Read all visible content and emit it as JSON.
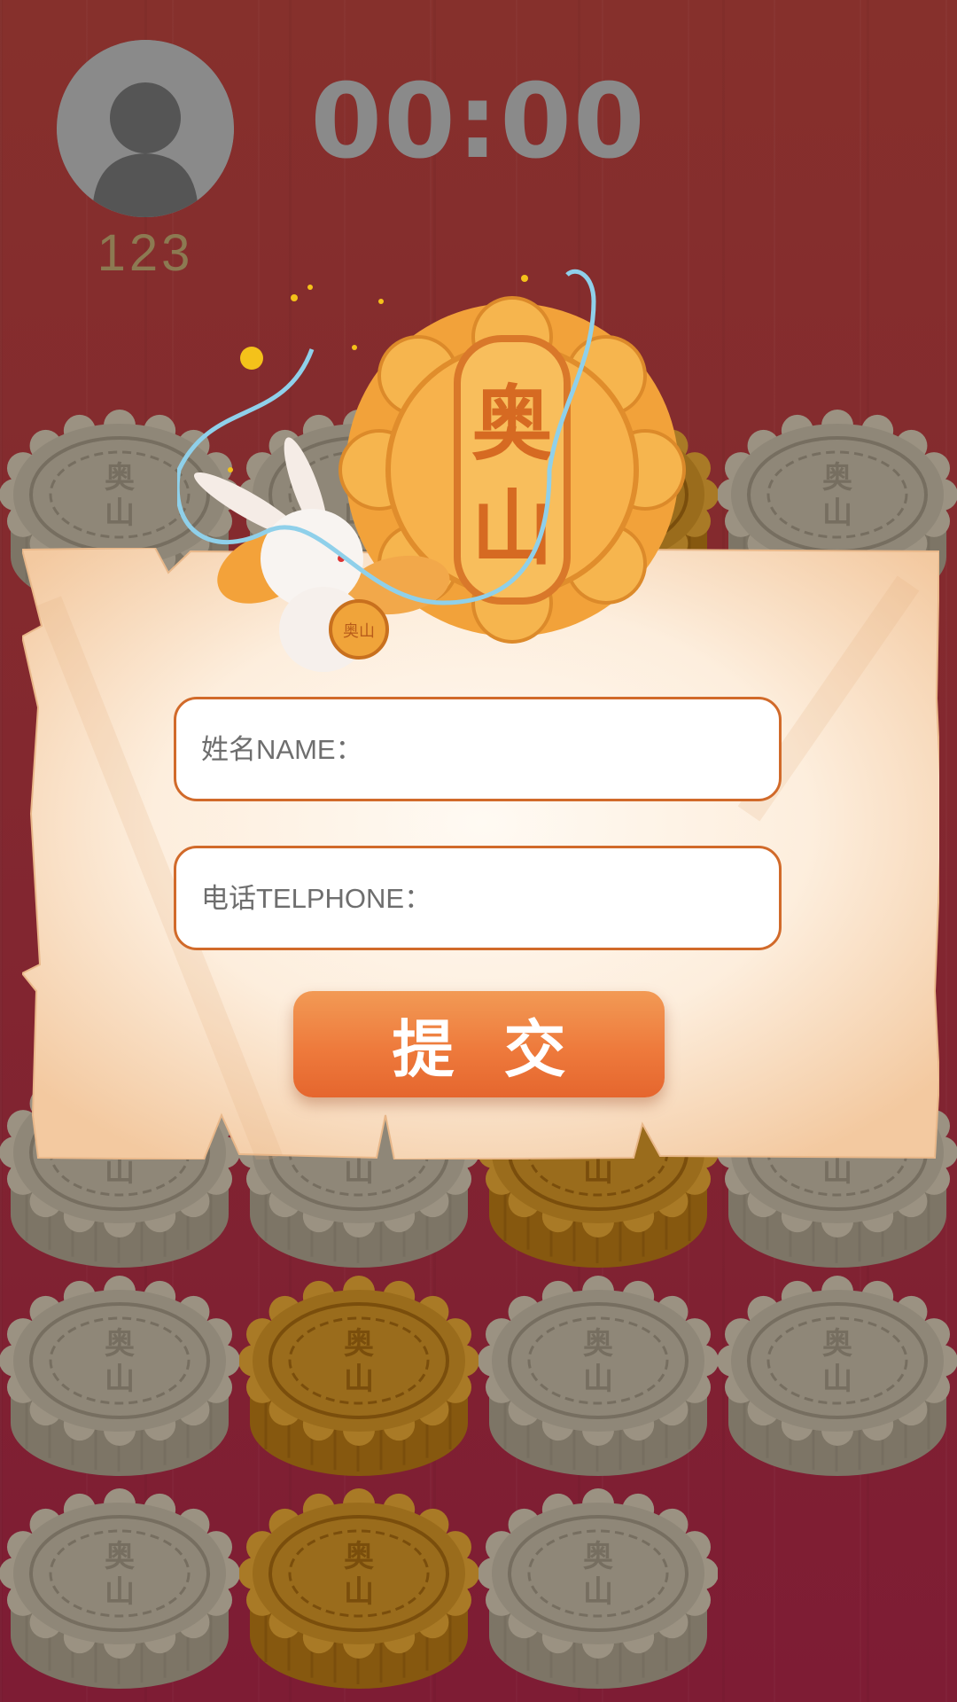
{
  "player": {
    "score": "123",
    "avatar_icon": "user-avatar-icon"
  },
  "timer": {
    "value": "00:00"
  },
  "hero": {
    "mooncake_top": "奥",
    "mooncake_bottom": "山",
    "badge_text": "奥山"
  },
  "tiles": {
    "label_top": "奥",
    "label_bottom": "山",
    "rows": [
      [
        "grey",
        "grey",
        "gold",
        "grey"
      ],
      [
        "grey",
        "grey",
        "gold",
        "grey"
      ],
      [
        "grey",
        "gold",
        "grey",
        "grey"
      ],
      [
        "grey",
        "gold",
        "grey"
      ]
    ]
  },
  "form": {
    "name_placeholder": "姓名NAME：",
    "phone_placeholder": "电话TELPHONE：",
    "submit_label": "提交"
  },
  "colors": {
    "background": "#84262f",
    "field_border": "#d16a2a",
    "button": "#ee7a3c",
    "tile_grey": "#8a8070",
    "tile_gold": "#9a6a18"
  }
}
